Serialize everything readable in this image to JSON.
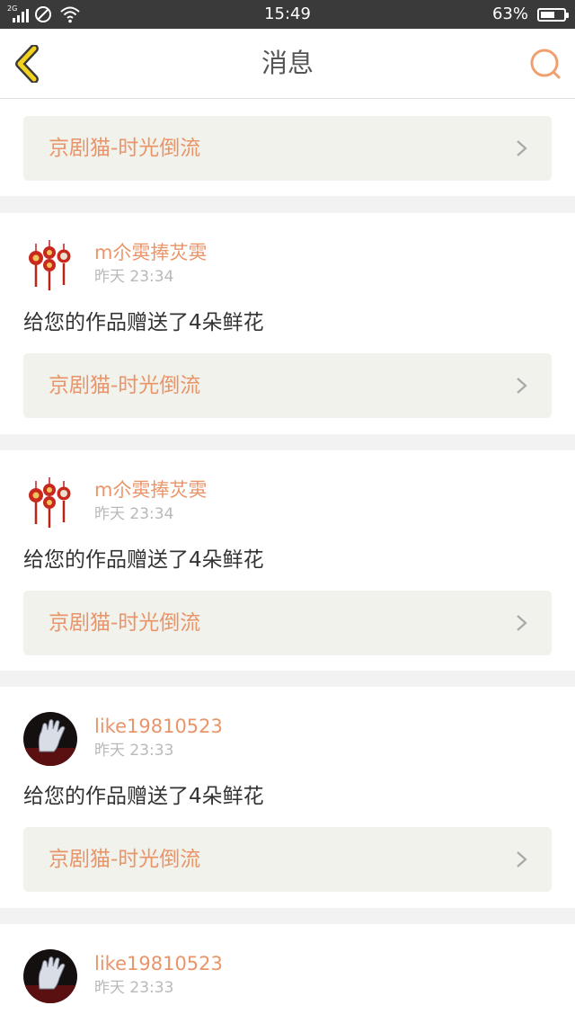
{
  "status_bar": {
    "network_tag": "2G",
    "time": "15:49",
    "battery_percent": "63%",
    "battery_level": 0.63,
    "icons": [
      "signal-icon",
      "no-sim-icon",
      "wifi-icon",
      "battery-icon"
    ]
  },
  "header": {
    "title": "消息",
    "back_icon": "chevron-left-icon",
    "search_icon": "search-icon",
    "accent_color": "#e8956a"
  },
  "top_card": {
    "work_title": "京剧猫-时光倒流"
  },
  "notifications": [
    {
      "user": "m尒雵捧炗雵",
      "time": "昨天 23:34",
      "message": "给您的作品赠送了4朵鲜花",
      "work_title": "京剧猫-时光倒流",
      "avatar": "red-lanterns-avatar"
    },
    {
      "user": "m尒雵捧炗雵",
      "time": "昨天 23:34",
      "message": "给您的作品赠送了4朵鲜花",
      "work_title": "京剧猫-时光倒流",
      "avatar": "red-lanterns-avatar"
    },
    {
      "user": "like19810523",
      "time": "昨天 23:33",
      "message": "给您的作品赠送了4朵鲜花",
      "work_title": "京剧猫-时光倒流",
      "avatar": "glove-avatar"
    },
    {
      "user": "like19810523",
      "time": "昨天 23:33",
      "avatar": "glove-avatar"
    }
  ]
}
